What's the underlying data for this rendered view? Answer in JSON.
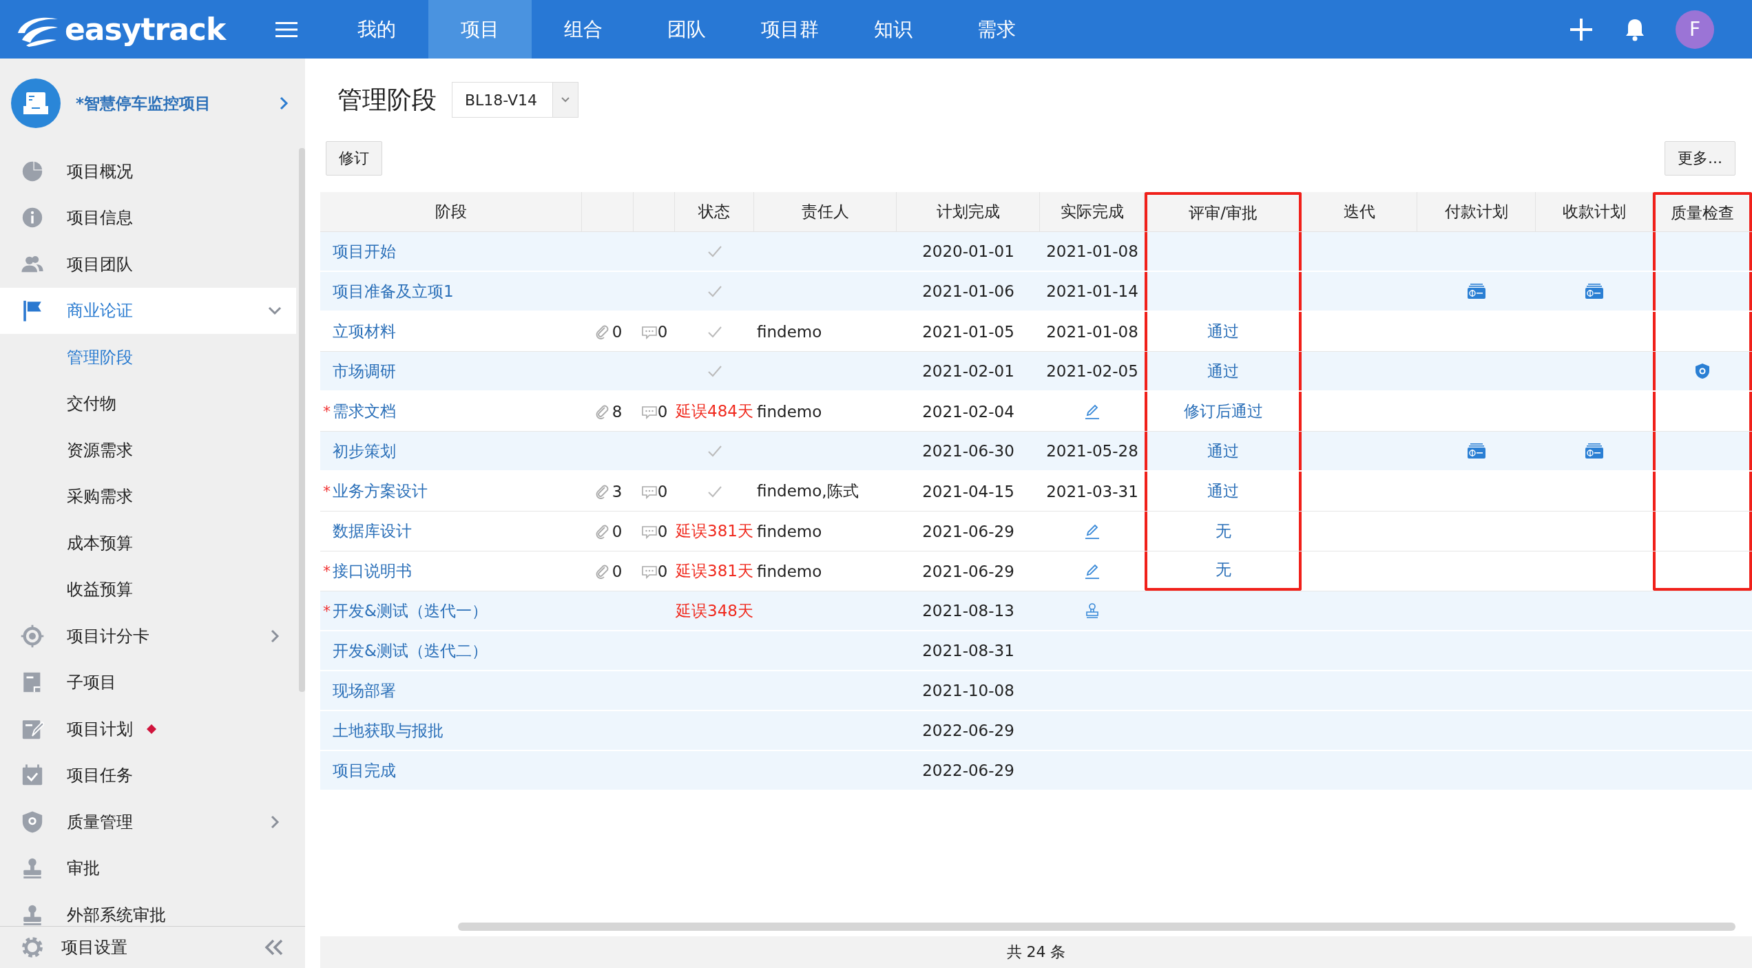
{
  "top_bar": {
    "logo": "easytrack",
    "nav": [
      {
        "label": "我的",
        "selected": false
      },
      {
        "label": "项目",
        "selected": true
      },
      {
        "label": "组合",
        "selected": false
      },
      {
        "label": "团队",
        "selected": false
      },
      {
        "label": "项目群",
        "selected": false
      },
      {
        "label": "知识",
        "selected": false
      },
      {
        "label": "需求",
        "selected": false
      }
    ],
    "avatar": "F"
  },
  "sidebar": {
    "project": "*智慧停车监控项目",
    "items": [
      {
        "label": "项目概况",
        "selected": false
      },
      {
        "label": "项目信息",
        "selected": false
      },
      {
        "label": "项目团队",
        "selected": false
      },
      {
        "label": "商业论证",
        "selected": true,
        "expanded": true,
        "children": [
          {
            "label": "管理阶段",
            "selected": true
          },
          {
            "label": "交付物",
            "selected": false
          },
          {
            "label": "资源需求",
            "selected": false
          },
          {
            "label": "采购需求",
            "selected": false
          },
          {
            "label": "成本预算",
            "selected": false
          },
          {
            "label": "收益预算",
            "selected": false
          }
        ]
      },
      {
        "label": "项目计分卡",
        "selected": false,
        "expanded": false
      },
      {
        "label": "子项目",
        "selected": false
      },
      {
        "label": "项目计划",
        "selected": false,
        "flagged": true
      },
      {
        "label": "项目任务",
        "selected": false
      },
      {
        "label": "质量管理",
        "selected": false,
        "expanded": false
      },
      {
        "label": "审批",
        "selected": false
      },
      {
        "label": "外部系统审批",
        "selected": false
      }
    ],
    "footer": "项目设置"
  },
  "page": {
    "title": "管理阶段",
    "version": "BL18-V14",
    "buttons": [
      "修订",
      "更多..."
    ]
  },
  "table": {
    "columns": [
      {
        "label": "阶段",
        "highlighted": false
      },
      {
        "highlighted": false
      },
      {
        "highlighted": false
      },
      {
        "label": "状态",
        "highlighted": false
      },
      {
        "label": "责任人",
        "highlighted": false
      },
      {
        "label": "计划完成",
        "highlighted": false
      },
      {
        "label": "实际完成",
        "highlighted": false
      },
      {
        "label": "评审/审批",
        "highlighted": true
      },
      {
        "label": "迭代",
        "highlighted": false
      },
      {
        "label": "付款计划",
        "highlighted": false
      },
      {
        "label": "收款计划",
        "highlighted": false
      },
      {
        "label": "质量检查",
        "highlighted": true
      }
    ],
    "rows": [
      {
        "name": "项目开始",
        "milestone": true,
        "highlighted": true,
        "status": {
          "kind": "done"
        },
        "plan": "2020-01-01",
        "actual": {
          "kind": "date",
          "text": "2021-01-08"
        },
        "payment_plan": false,
        "receipt_plan": false,
        "quality_check": false
      },
      {
        "name": "项目准备及立项1",
        "milestone": true,
        "highlighted": true,
        "status": {
          "kind": "done"
        },
        "plan": "2021-01-06",
        "actual": {
          "kind": "date",
          "text": "2021-01-14"
        },
        "payment_plan": true,
        "receipt_plan": true,
        "quality_check": false
      },
      {
        "name": "立项材料",
        "milestone": false,
        "highlighted": true,
        "attachments": "0",
        "comments": "0",
        "status": {
          "kind": "done"
        },
        "owner": "findemo",
        "plan": "2021-01-05",
        "actual": {
          "kind": "date",
          "text": "2021-01-08"
        },
        "review": "通过",
        "payment_plan": false,
        "receipt_plan": false,
        "quality_check": false
      },
      {
        "name": "市场调研",
        "milestone": true,
        "highlighted": true,
        "status": {
          "kind": "done"
        },
        "plan": "2021-02-01",
        "actual": {
          "kind": "date",
          "text": "2021-02-05"
        },
        "review": "通过",
        "payment_plan": false,
        "receipt_plan": false,
        "quality_check": true
      },
      {
        "name": "需求文档",
        "required_mark": "*",
        "milestone": false,
        "highlighted": true,
        "attachments": "8",
        "comments": "0",
        "status": {
          "kind": "delayed",
          "text": "延误484天"
        },
        "owner": "findemo",
        "plan": "2021-02-04",
        "actual": {
          "kind": "edit"
        },
        "review": "修订后通过",
        "payment_plan": false,
        "receipt_plan": false,
        "quality_check": false
      },
      {
        "name": "初步策划",
        "milestone": true,
        "highlighted": true,
        "status": {
          "kind": "done"
        },
        "plan": "2021-06-30",
        "actual": {
          "kind": "date",
          "text": "2021-05-28"
        },
        "review": "通过",
        "payment_plan": true,
        "receipt_plan": true,
        "quality_check": false
      },
      {
        "name": "业务方案设计",
        "required_mark": "*",
        "milestone": false,
        "highlighted": true,
        "attachments": "3",
        "comments": "0",
        "status": {
          "kind": "done"
        },
        "owner": "findemo,陈式",
        "plan": "2021-04-15",
        "actual": {
          "kind": "date",
          "text": "2021-03-31"
        },
        "review": "通过",
        "payment_plan": false,
        "receipt_plan": false,
        "quality_check": false
      },
      {
        "name": "数据库设计",
        "milestone": false,
        "highlighted": true,
        "attachments": "0",
        "comments": "0",
        "status": {
          "kind": "delayed",
          "text": "延误381天"
        },
        "owner": "findemo",
        "plan": "2021-06-29",
        "actual": {
          "kind": "edit"
        },
        "review": "无",
        "payment_plan": false,
        "receipt_plan": false,
        "quality_check": false
      },
      {
        "name": "接口说明书",
        "required_mark": "*",
        "milestone": false,
        "highlighted": true,
        "attachments": "0",
        "comments": "0",
        "status": {
          "kind": "delayed",
          "text": "延误381天"
        },
        "owner": "findemo",
        "plan": "2021-06-29",
        "actual": {
          "kind": "edit"
        },
        "review": "无",
        "payment_plan": false,
        "receipt_plan": false,
        "quality_check": false
      },
      {
        "name": "开发&测试（迭代一）",
        "required_mark": "*",
        "milestone": true,
        "highlighted": false,
        "status": {
          "kind": "delayed",
          "text": "延误348天"
        },
        "plan": "2021-08-13",
        "actual": {
          "kind": "stamp"
        },
        "payment_plan": false,
        "receipt_plan": false,
        "quality_check": false
      },
      {
        "name": "开发&测试（迭代二）",
        "milestone": true,
        "highlighted": false,
        "plan": "2021-08-31",
        "payment_plan": false,
        "receipt_plan": false,
        "quality_check": false
      },
      {
        "name": "现场部署",
        "milestone": true,
        "highlighted": false,
        "plan": "2021-10-08",
        "payment_plan": false,
        "receipt_plan": false,
        "quality_check": false
      },
      {
        "name": "土地获取与报批",
        "milestone": true,
        "highlighted": false,
        "plan": "2022-06-29",
        "payment_plan": false,
        "receipt_plan": false,
        "quality_check": false
      },
      {
        "name": "项目完成",
        "milestone": true,
        "highlighted": false,
        "plan": "2022-06-29",
        "payment_plan": false,
        "receipt_plan": false,
        "quality_check": false
      }
    ],
    "footer": "共 24 条"
  }
}
